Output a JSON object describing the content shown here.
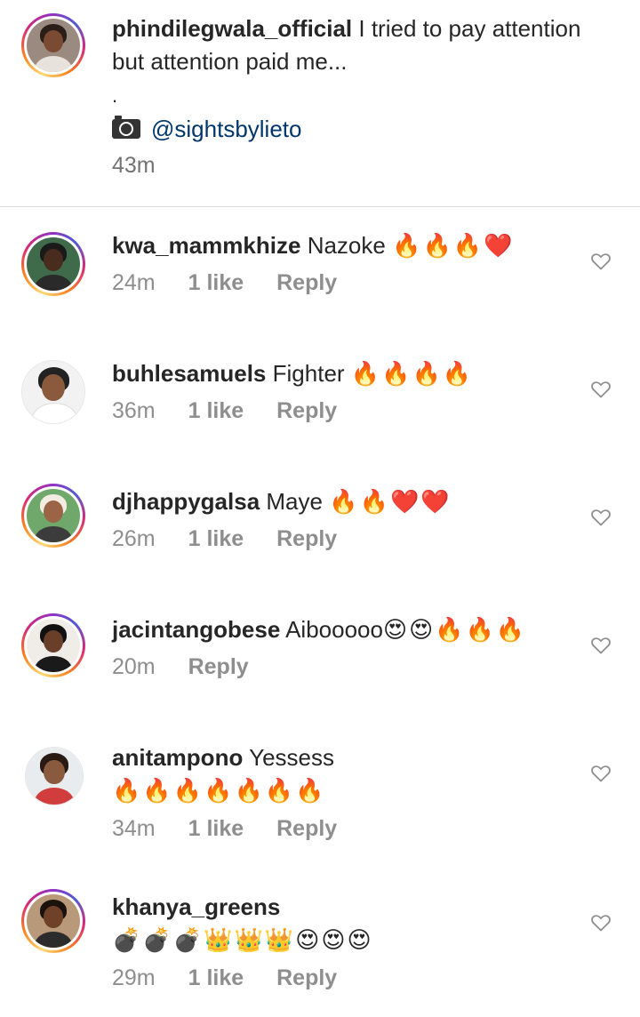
{
  "caption": {
    "username": "phindilegwala_official",
    "text": "I tried to pay attention but attention paid me...",
    "dot": ".",
    "credit": "@sightsbylieto",
    "time": "43m"
  },
  "comments": [
    {
      "username": "kwa_mammkhize",
      "text": "Nazoke",
      "emoji": "🔥🔥🔥❤️",
      "time": "24m",
      "likes": "1 like",
      "reply": "Reply"
    },
    {
      "username": "buhlesamuels",
      "text": "Fighter",
      "emoji": "🔥🔥🔥🔥",
      "time": "36m",
      "likes": "1 like",
      "reply": "Reply"
    },
    {
      "username": "djhappygalsa",
      "text": "Maye",
      "emoji": "🔥🔥❤️❤️",
      "time": "26m",
      "likes": "1 like",
      "reply": "Reply"
    },
    {
      "username": "jacintangobese",
      "text": "Aibooooo",
      "emoji": "😍😍🔥🔥🔥",
      "time": "20m",
      "likes": "",
      "reply": "Reply"
    },
    {
      "username": "anitampono",
      "text": "Yessess",
      "emoji": "🔥🔥🔥🔥🔥🔥🔥",
      "time": "34m",
      "likes": "1 like",
      "reply": "Reply"
    },
    {
      "username": "khanya_greens",
      "text": "",
      "emoji": "💣💣💣👑👑👑😍😍😍",
      "time": "29m",
      "likes": "1 like",
      "reply": "Reply"
    }
  ],
  "icons": {
    "like": "heart-outline-icon",
    "camera": "camera-icon"
  },
  "colors": {
    "link": "#00376b",
    "meta": "#8e8e8e",
    "divider": "#dbdbdb"
  }
}
